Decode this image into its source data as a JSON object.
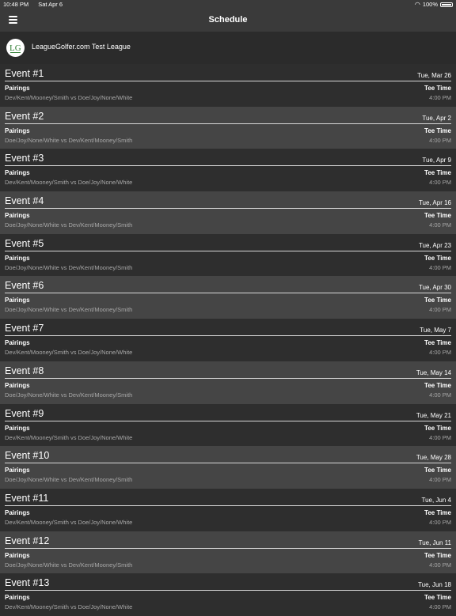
{
  "status_bar": {
    "time": "10:48 PM",
    "date": "Sat Apr 6",
    "battery": "100%"
  },
  "nav": {
    "title": "Schedule"
  },
  "league": {
    "logo_text": "LG",
    "name": "LeagueGolfer.com Test League"
  },
  "labels": {
    "pairings": "Pairings",
    "tee_time": "Tee Time"
  },
  "events": [
    {
      "title": "Event #1",
      "date": "Tue, Mar 26",
      "pairing": "Dev/Kent/Mooney/Smith vs Doe/Joy/None/White",
      "tee": "4:00 PM"
    },
    {
      "title": "Event #2",
      "date": "Tue, Apr 2",
      "pairing": "Doe/Joy/None/White vs Dev/Kent/Mooney/Smith",
      "tee": "4:00 PM"
    },
    {
      "title": "Event #3",
      "date": "Tue, Apr 9",
      "pairing": "Dev/Kent/Mooney/Smith vs Doe/Joy/None/White",
      "tee": "4:00 PM"
    },
    {
      "title": "Event #4",
      "date": "Tue, Apr 16",
      "pairing": "Doe/Joy/None/White vs Dev/Kent/Mooney/Smith",
      "tee": "4:00 PM"
    },
    {
      "title": "Event #5",
      "date": "Tue, Apr 23",
      "pairing": "Doe/Joy/None/White vs Dev/Kent/Mooney/Smith",
      "tee": "4:00 PM"
    },
    {
      "title": "Event #6",
      "date": "Tue, Apr 30",
      "pairing": "Doe/Joy/None/White vs Dev/Kent/Mooney/Smith",
      "tee": "4:00 PM"
    },
    {
      "title": "Event #7",
      "date": "Tue, May 7",
      "pairing": "Dev/Kent/Mooney/Smith vs Doe/Joy/None/White",
      "tee": "4:00 PM"
    },
    {
      "title": "Event #8",
      "date": "Tue, May 14",
      "pairing": "Doe/Joy/None/White vs Dev/Kent/Mooney/Smith",
      "tee": "4:00 PM"
    },
    {
      "title": "Event #9",
      "date": "Tue, May 21",
      "pairing": "Dev/Kent/Mooney/Smith vs Doe/Joy/None/White",
      "tee": "4:00 PM"
    },
    {
      "title": "Event #10",
      "date": "Tue, May 28",
      "pairing": "Doe/Joy/None/White vs Dev/Kent/Mooney/Smith",
      "tee": "4:00 PM"
    },
    {
      "title": "Event #11",
      "date": "Tue, Jun 4",
      "pairing": "Dev/Kent/Mooney/Smith vs Doe/Joy/None/White",
      "tee": "4:00 PM"
    },
    {
      "title": "Event #12",
      "date": "Tue, Jun 11",
      "pairing": "Doe/Joy/None/White vs Dev/Kent/Mooney/Smith",
      "tee": "4:00 PM"
    },
    {
      "title": "Event #13",
      "date": "Tue, Jun 18",
      "pairing": "Dev/Kent/Mooney/Smith vs Doe/Joy/None/White",
      "tee": "4:00 PM"
    }
  ]
}
